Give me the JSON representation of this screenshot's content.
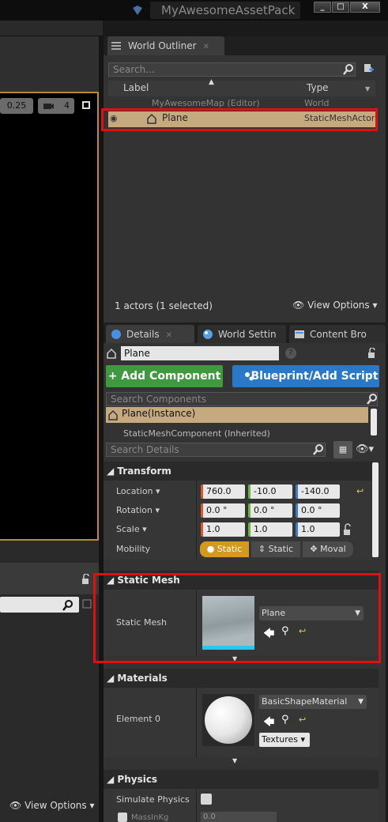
{
  "window": {
    "title": "MyAwesomeAssetPack",
    "minimize": "_",
    "maximize": "□",
    "close": "X"
  },
  "viewport": {
    "snap_value": "0.25",
    "camera_speed": "4"
  },
  "outliner": {
    "tab_label": "World Outliner",
    "search_placeholder": "Search...",
    "col_label": "Label",
    "col_type": "Type",
    "rows": [
      {
        "label": "MyAwesomeMap (Editor)",
        "type": "World"
      },
      {
        "label": "Plane",
        "type": "StaticMeshActor"
      }
    ],
    "status": "1 actors (1 selected)",
    "view_options": "View Options"
  },
  "details": {
    "tabs": [
      "Details",
      "World Settin",
      "Content Bro"
    ],
    "actor_name": "Plane",
    "add_component": "+ Add Component",
    "blueprint": "Blueprint/Add Script",
    "search_components_placeholder": "Search Components",
    "component_root": "Plane(Instance)",
    "component_child": "StaticMeshComponent (Inherited)",
    "search_details_placeholder": "Search Details",
    "transform": {
      "header": "Transform",
      "location_label": "Location",
      "location": [
        "760.0",
        "-10.0",
        "-140.0"
      ],
      "rotation_label": "Rotation",
      "rotation": [
        "0.0 °",
        "0.0 °",
        "0.0 °"
      ],
      "scale_label": "Scale",
      "scale": [
        "1.0",
        "1.0",
        "1.0"
      ],
      "mobility_label": "Mobility",
      "mobility": [
        "Static",
        "Static",
        "Moval"
      ]
    },
    "static_mesh": {
      "header": "Static Mesh",
      "label": "Static Mesh",
      "value": "Plane"
    },
    "materials": {
      "header": "Materials",
      "label": "Element 0",
      "value": "BasicShapeMaterial",
      "textures": "Textures"
    },
    "physics": {
      "header": "Physics",
      "simulate_label": "Simulate Physics",
      "mass_label": "MassInKg",
      "mass_value": "0.0"
    }
  },
  "left_bottom": {
    "view_options": "View Options"
  },
  "colors": {
    "selection": "#c5a97f",
    "highlight_box": "#e01010",
    "green_button": "#3f9a3f",
    "blue_button": "#2a78c8"
  }
}
